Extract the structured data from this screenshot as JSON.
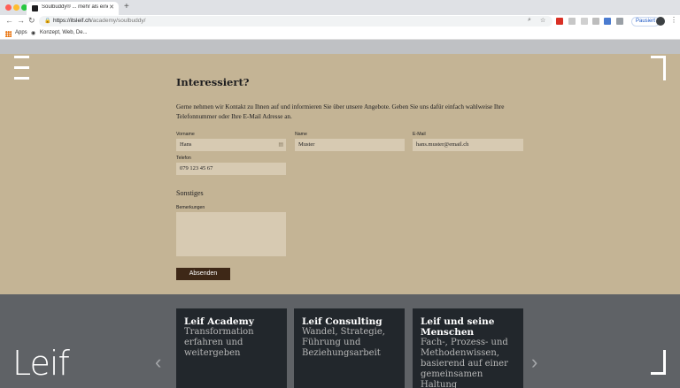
{
  "browser": {
    "tab_title": "Soulbuddy® ... mehr als eine C...",
    "url_host": "https://itsleif.ch",
    "url_path": "/academy/soulbuddy/",
    "profile_status": "Pausiert",
    "bookmarks": [
      "Apps",
      "Konzept, Web, De..."
    ]
  },
  "form": {
    "heading": "Interessiert?",
    "intro": "Gerne nehmen wir Kontakt zu Ihnen auf und informieren Sie über unsere Angebote. Geben Sie uns dafür einfach wahlweise Ihre Telefonnummer oder Ihre E-Mail Adresse an.",
    "fields": {
      "vorname": {
        "label": "Vorname",
        "value": "Hans"
      },
      "name": {
        "label": "Name",
        "value": "Muster"
      },
      "email": {
        "label": "E-Mail",
        "value": "hans.muster@email.ch"
      },
      "telefon": {
        "label": "Telefon",
        "value": "079 123 45 67"
      },
      "bemerkungen": {
        "label": "Bemerkungen",
        "value": ""
      }
    },
    "section_other": "Sonstiges",
    "submit_label": "Absenden"
  },
  "footer": {
    "logo": "Leif",
    "cards": [
      {
        "title": "Leif Academy",
        "subtitle": "Transformation erfahren und weitergeben"
      },
      {
        "title": "Leif Consulting",
        "subtitle": "Wandel, Strategie, Führung und Beziehungsarbeit"
      },
      {
        "title": "Leif und seine Menschen",
        "subtitle": "Fach-, Prozess- und Methodenwissen, basierend auf einer gemeinsamen Haltung"
      }
    ]
  },
  "colors": {
    "page_bg": "#c4b495",
    "input_bg": "#d7cab2",
    "button_bg": "#3e2817",
    "footer_bg": "#5f6266",
    "card_bg": "#22272c"
  }
}
